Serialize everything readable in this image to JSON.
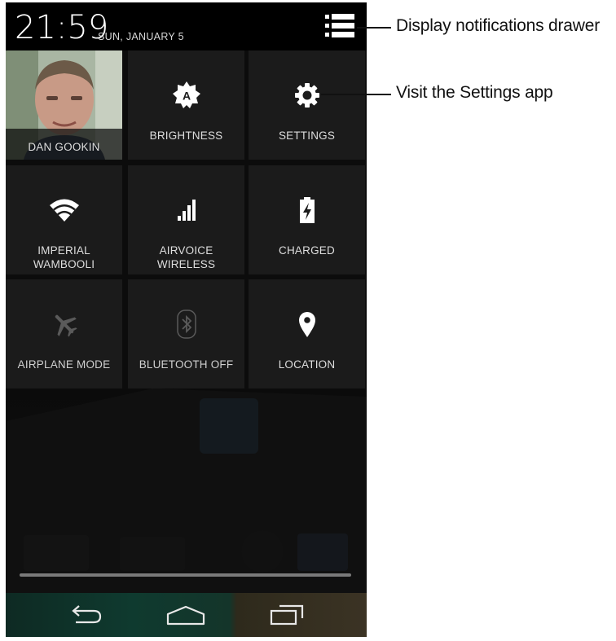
{
  "status_bar": {
    "time": "21:59",
    "date": "SUN, JANUARY 5"
  },
  "quick_settings": {
    "user": {
      "label": "DAN GOOKIN"
    },
    "brightness": {
      "label": "BRIGHTNESS"
    },
    "settings": {
      "label": "SETTINGS"
    },
    "wifi": {
      "label_line1": "IMPERIAL",
      "label_line2": "WAMBOOLI"
    },
    "cellular": {
      "label_line1": "AIRVOICE",
      "label_line2": "WIRELESS"
    },
    "battery": {
      "label": "CHARGED"
    },
    "airplane": {
      "label": "AIRPLANE MODE"
    },
    "bluetooth": {
      "label": "BLUETOOTH OFF"
    },
    "location": {
      "label": "LOCATION"
    }
  },
  "callouts": {
    "drawer": "Display notifications drawer",
    "settings": "Visit the Settings app"
  },
  "colors": {
    "tile_bg": "#1b1b1b",
    "panel_bg": "#0c0c0c",
    "icon_white": "#ffffff",
    "icon_dim": "#5a5a5a"
  }
}
